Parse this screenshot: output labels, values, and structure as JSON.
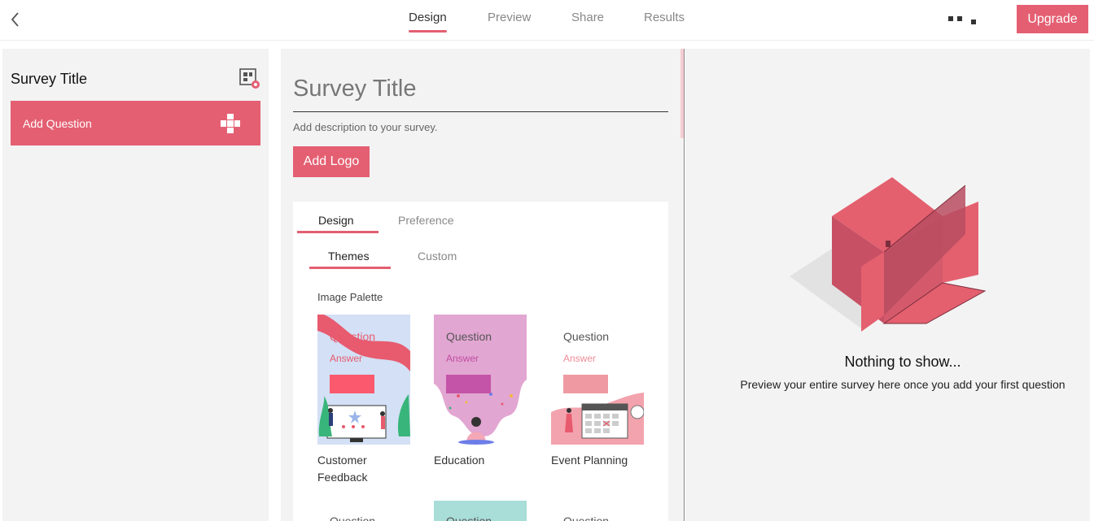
{
  "topbar": {
    "tabs": [
      "Design",
      "Preview",
      "Share",
      "Results"
    ],
    "active_tab": "Design",
    "upgrade_label": "Upgrade"
  },
  "sidebar": {
    "title": "Survey Title",
    "add_question_label": "Add Question"
  },
  "editor": {
    "survey_title": "Survey Title",
    "description_placeholder": "Add description to your survey.",
    "add_logo_label": "Add Logo",
    "tabs": [
      "Design",
      "Preference"
    ],
    "subtabs": [
      "Themes",
      "Custom"
    ],
    "palette_label": "Image Palette",
    "themes": [
      {
        "name": "Customer Feedback",
        "question": "Question",
        "answer": "Answer"
      },
      {
        "name": "Education",
        "question": "Question",
        "answer": "Answer"
      },
      {
        "name": "Event Planning",
        "question": "Question",
        "answer": "Answer"
      }
    ],
    "next_row_question": "Question"
  },
  "preview": {
    "empty_title": "Nothing to show...",
    "empty_subtitle": "Preview your entire survey here once you add your first question"
  },
  "colors": {
    "accent": "#e45f72",
    "panel_bg": "#f3f3f3",
    "education_bg": "#e2a6d2",
    "feedback_bg": "#d2e0f4",
    "teal_theme": "#a8ddd8"
  }
}
